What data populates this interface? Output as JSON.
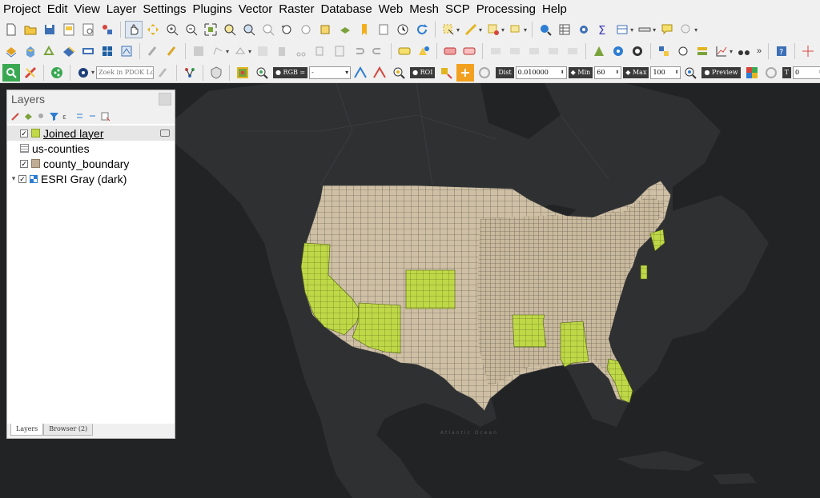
{
  "menu": [
    "Project",
    "Edit",
    "View",
    "Layer",
    "Settings",
    "Plugins",
    "Vector",
    "Raster",
    "Database",
    "Web",
    "Mesh",
    "SCP",
    "Processing",
    "Help"
  ],
  "toolbar3": {
    "pdok_placeholder": "Zoek in PDOK Loc···",
    "rgb_label": "RGB =",
    "band_value": "-",
    "roi_label": "ROI",
    "dist_label": "Dist",
    "dist_value": "0.010000",
    "min_label": "Min",
    "min_value": "60",
    "max_label": "Max",
    "max_value": "100",
    "preview_label": "Preview",
    "t_label": "T",
    "t_value": "0",
    "s_label": "S"
  },
  "layers_panel": {
    "title": "Layers",
    "layers": [
      {
        "name": "Joined layer",
        "checked": true,
        "swatch": "#c0d84a",
        "type": "polygon",
        "selected": true
      },
      {
        "name": "us-counties",
        "checked": null,
        "swatch": null,
        "type": "table",
        "selected": false
      },
      {
        "name": "county_boundary",
        "checked": true,
        "swatch": "#bfae95",
        "type": "polygon",
        "selected": false
      },
      {
        "name": "ESRI Gray (dark)",
        "checked": true,
        "swatch": null,
        "type": "raster",
        "selected": false
      }
    ],
    "tabs": [
      "Layers",
      "Browser (2)"
    ]
  },
  "map": {
    "background": "#222325",
    "land_color": "#2f3032",
    "county_fill": "#cfc0a5",
    "county_stroke": "#3a3a3a",
    "highlight_fill": "#bfd847",
    "ocean_label": "Atlantic Ocean"
  }
}
